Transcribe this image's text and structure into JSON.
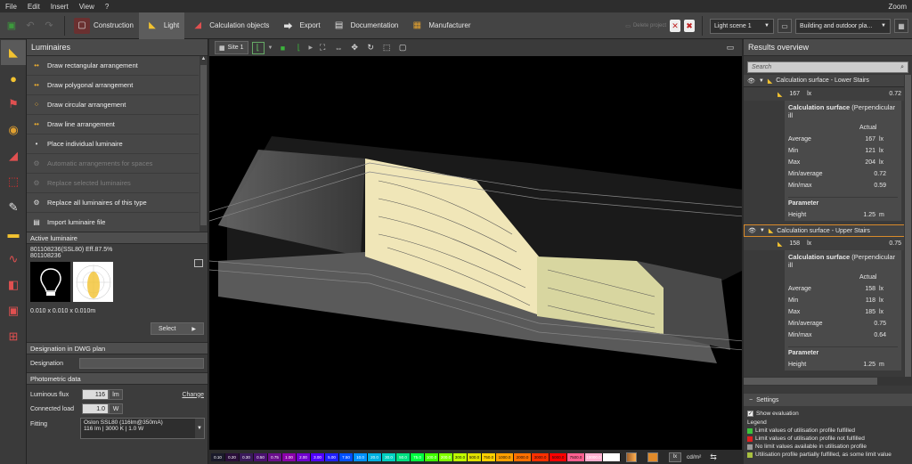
{
  "menu": {
    "items": [
      "File",
      "Edit",
      "Insert",
      "View",
      "?"
    ],
    "zoom_label": "Zoom"
  },
  "toolbar": {
    "tabs": [
      {
        "label": "Construction",
        "icon": "construction-icon"
      },
      {
        "label": "Light",
        "icon": "light-icon"
      },
      {
        "label": "Calculation objects",
        "icon": "calculation-objects-icon"
      },
      {
        "label": "Export",
        "icon": "export-icon"
      },
      {
        "label": "Documentation",
        "icon": "documentation-icon"
      },
      {
        "label": "Manufacturer",
        "icon": "manufacturer-icon"
      }
    ],
    "fake_label": "Delete project",
    "light_scene": "Light scene 1",
    "planning_scene": "Building and outdoor pla..."
  },
  "luminaires": {
    "title": "Luminaires",
    "items": [
      {
        "label": "Draw rectangular arrangement",
        "enabled": true
      },
      {
        "label": "Draw polygonal arrangement",
        "enabled": true
      },
      {
        "label": "Draw circular arrangement",
        "enabled": true
      },
      {
        "label": "Draw line arrangement",
        "enabled": true
      },
      {
        "label": "Place individual luminaire",
        "enabled": true
      },
      {
        "label": "Automatic arrangements for spaces",
        "enabled": false
      },
      {
        "label": "Replace selected luminaires",
        "enabled": false
      },
      {
        "label": "Replace all luminaires of this type",
        "enabled": true
      },
      {
        "label": "Import luminaire file",
        "enabled": true
      }
    ]
  },
  "active_luminaire": {
    "title": "Active luminaire",
    "name": "801108236(SSL80) Eff.87.5%",
    "code": "801108236",
    "dims": "0.010 x 0.010 x 0.010m",
    "select_label": "Select"
  },
  "designation": {
    "title": "Designation in DWG plan",
    "label": "Designation",
    "value": ""
  },
  "photometric": {
    "title": "Photometric data",
    "flux_label": "Luminous flux",
    "flux_value": "116",
    "flux_unit": "lm",
    "change_label": "Change",
    "load_label": "Connected load",
    "load_value": "1.0",
    "load_unit": "W",
    "fitting_label": "Fitting",
    "fitting_line1": "Oslon SSL80 (116lm@350mA)",
    "fitting_line2": "116 lm  |  3000 K  |  1.0 W"
  },
  "viewport": {
    "site_label": "Site 1",
    "legend": [
      "0.10",
      "0.20",
      "0.30",
      "0.50",
      "0.75",
      "1.00",
      "2.00",
      "3.00",
      "5.00",
      "7.50",
      "10.0",
      "20.0",
      "30.0",
      "50.0",
      "75.0",
      "100.0",
      "200.0",
      "300.0",
      "500.0",
      "750.0",
      "1000.0",
      "2000.0",
      "3000.0",
      "5000.0",
      "7500.0",
      "10000.0",
      "20000.0"
    ],
    "legend_colors": [
      "#1a1a2a",
      "#2a0f3a",
      "#3a1a5a",
      "#4a1070",
      "#6a0e8c",
      "#8a00aa",
      "#7000d0",
      "#5000ff",
      "#2020ff",
      "#0050ff",
      "#0090ff",
      "#00b0e0",
      "#00d0c0",
      "#00e080",
      "#00ff40",
      "#40ff00",
      "#80ff00",
      "#c0ff00",
      "#e0e000",
      "#ffd000",
      "#ffa000",
      "#ff7000",
      "#ff3000",
      "#ff0000",
      "#ff6090",
      "#ffb0d0",
      "#ffffff"
    ],
    "unit_lx": "lx",
    "unit_cd": "cd/m²"
  },
  "results": {
    "title": "Results overview",
    "search_placeholder": "Search",
    "surfaces": [
      {
        "name": "Calculation surface - Lower Stairs",
        "value": "167",
        "unit": "lx",
        "ratio": "0.72",
        "card_title": "Calculation surface",
        "card_sub": "(Perpendicular ill",
        "actual_label": "Actual",
        "average": "167",
        "min": "121",
        "max": "204",
        "min_average": "0.72",
        "min_max": "0.59",
        "height": "1.25"
      },
      {
        "name": "Calculation surface - Upper Stairs",
        "value": "158",
        "unit": "lx",
        "ratio": "0.75",
        "card_title": "Calculation surface",
        "card_sub": "(Perpendicular ill",
        "actual_label": "Actual",
        "average": "158",
        "min": "118",
        "max": "185",
        "min_average": "0.75",
        "min_max": "0.64",
        "height": "1.25"
      }
    ],
    "labels": {
      "average": "Average",
      "min": "Min",
      "max": "Max",
      "min_average": "Min/average",
      "min_max": "Min/max",
      "parameter": "Parameter",
      "height": "Height",
      "lx": "lx",
      "m": "m"
    }
  },
  "settings": {
    "title": "Settings",
    "show_evaluation": "Show evaluation",
    "legend_title": "Legend",
    "legend_items": [
      {
        "color": "#3cc23c",
        "text": "Limit values of utilisation profile fulfilled"
      },
      {
        "color": "#e02020",
        "text": "Limit values of utilisation profile not fulfilled"
      },
      {
        "color": "#9a9a9a",
        "text": "No limit values available in utilisation profile"
      },
      {
        "color": "#a8c040",
        "text": "Utilisation profile partially fulfilled, as some limit value"
      }
    ]
  }
}
